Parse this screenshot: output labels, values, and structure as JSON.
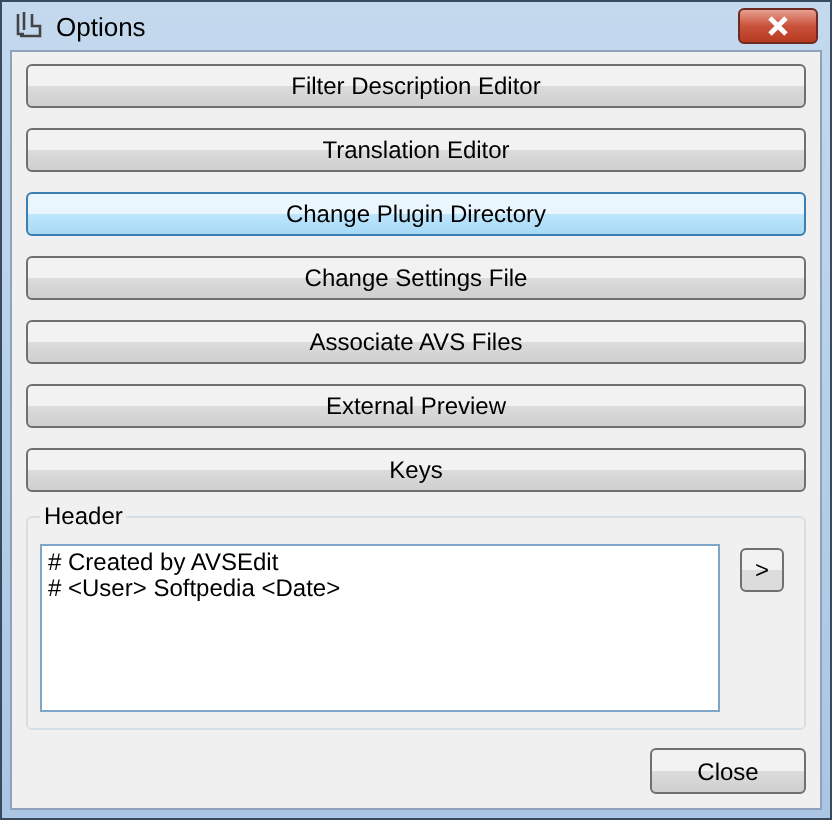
{
  "window": {
    "title": "Options"
  },
  "buttons": [
    {
      "label": "Filter Description Editor",
      "hovered": false
    },
    {
      "label": "Translation Editor",
      "hovered": false
    },
    {
      "label": "Change Plugin Directory",
      "hovered": true
    },
    {
      "label": "Change Settings File",
      "hovered": false
    },
    {
      "label": "Associate AVS Files",
      "hovered": false
    },
    {
      "label": "External Preview",
      "hovered": false
    },
    {
      "label": "Keys",
      "hovered": false
    }
  ],
  "header": {
    "label": "Header",
    "lines": [
      "# Created by AVSEdit",
      "# <User> Softpedia <Date>"
    ],
    "expand_button": ">"
  },
  "close_button": "Close"
}
